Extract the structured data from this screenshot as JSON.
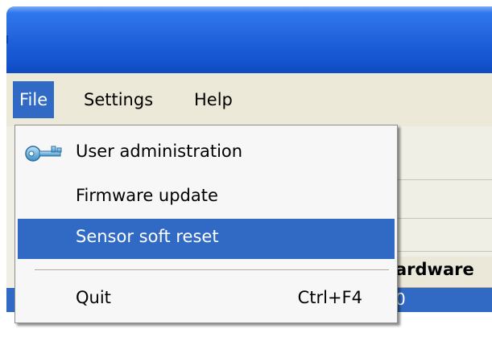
{
  "menubar": {
    "file_label": "File",
    "settings_label": "Settings",
    "help_label": "Help"
  },
  "file_menu": {
    "items": [
      {
        "label": "User administration",
        "icon": "key-icon",
        "shortcut": ""
      },
      {
        "label": "Firmware update",
        "shortcut": ""
      },
      {
        "label": "Sensor soft reset",
        "shortcut": "",
        "highlighted": true
      },
      {
        "label": "Quit",
        "shortcut": "Ctrl+F4"
      }
    ]
  },
  "table": {
    "partial_header": "ardware",
    "selected_row_partial_value": "0",
    "expander_symbol": "–"
  },
  "colors": {
    "titlebar": "#1d5fd8",
    "highlight": "#316ac5",
    "menu_background": "#f7f7f7",
    "window_background": "#ece9d8"
  }
}
